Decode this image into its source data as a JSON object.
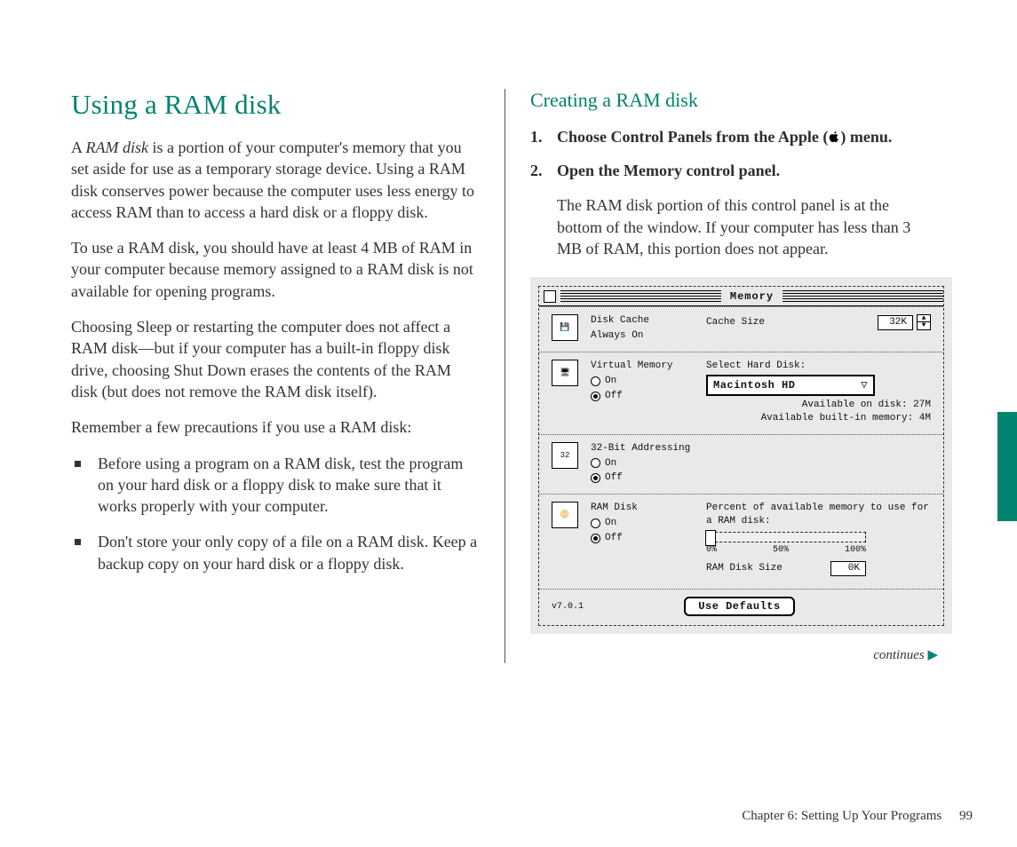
{
  "left": {
    "heading": "Using a RAM disk",
    "p1_a": "A ",
    "p1_italic": "RAM disk",
    "p1_b": " is a portion of your computer's memory that you set aside for use as a temporary storage device. Using a RAM disk conserves power because the computer uses less energy to access RAM than to access a hard disk or a floppy disk.",
    "p2": "To use a RAM disk, you should have at least 4 MB of RAM in your computer because memory assigned to a RAM disk is not available for opening programs.",
    "p3": "Choosing Sleep or restarting the computer does not affect a RAM disk—but if your computer has a built-in floppy disk drive, choosing Shut Down erases the contents of the RAM disk (but does not remove the RAM disk itself).",
    "p4": "Remember a few precautions if you use a RAM disk:",
    "bullets": [
      "Before using a program on a RAM disk, test the program on your hard disk or a floppy disk to make sure that it works properly with your computer.",
      "Don't store your only copy of a file on a RAM disk. Keep a backup copy on your hard disk or a floppy disk."
    ]
  },
  "right": {
    "heading": "Creating a RAM disk",
    "steps": [
      "Choose Control Panels from the Apple (🍎) menu.",
      "Open the Memory control panel."
    ],
    "note": "The RAM disk portion of this control panel is at the bottom of the window. If your computer has less than 3 MB of RAM, this portion does not appear.",
    "continues": "continues"
  },
  "panel": {
    "title": "Memory",
    "disk_cache": {
      "label": "Disk Cache",
      "sub": "Always On",
      "cache_label": "Cache Size",
      "cache_value": "32K"
    },
    "vm": {
      "label": "Virtual Memory",
      "on": "On",
      "off": "Off",
      "hd_label": "Select Hard Disk:",
      "hd_value": "Macintosh HD",
      "avail_disk": "Available on disk:  27M",
      "avail_mem": "Available built-in memory:  4M"
    },
    "addr": {
      "label": "32-Bit Addressing",
      "on": "On",
      "off": "Off"
    },
    "ramdisk": {
      "label": "RAM Disk",
      "on": "On",
      "off": "Off",
      "pct_label": "Percent of available memory to use for a RAM disk:",
      "pct_0": "0%",
      "pct_50": "50%",
      "pct_100": "100%",
      "size_label": "RAM Disk Size",
      "size_value": "0K"
    },
    "defaults": "Use Defaults",
    "version": "v7.0.1"
  },
  "footer": {
    "chapter": "Chapter 6: Setting Up Your Programs",
    "page": "99"
  }
}
